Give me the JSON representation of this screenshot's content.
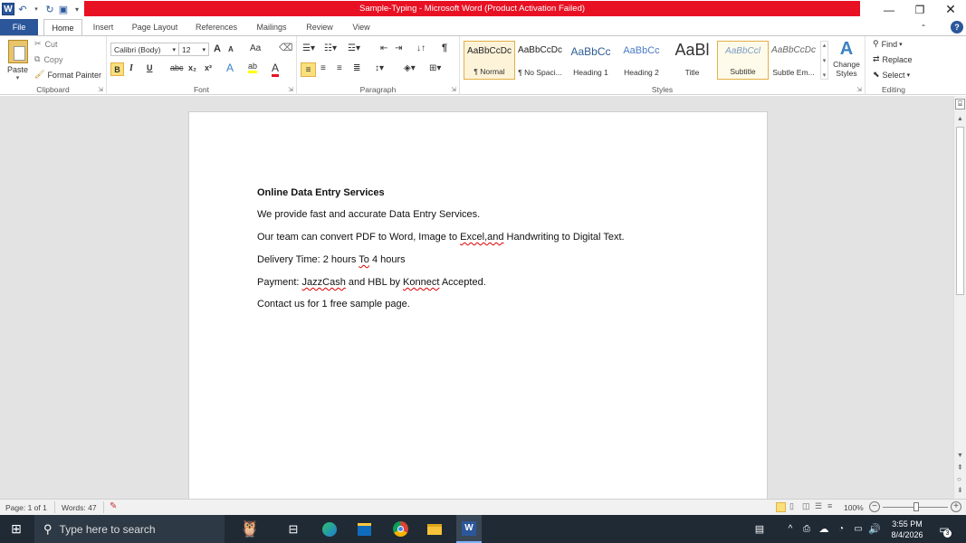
{
  "window": {
    "title": "Sample-Typing - Microsoft Word (Product Activation Failed)"
  },
  "qat": {
    "logo": "W"
  },
  "tabs": {
    "file": "File",
    "home": "Home",
    "insert": "Insert",
    "page_layout": "Page Layout",
    "references": "References",
    "mailings": "Mailings",
    "review": "Review",
    "view": "View"
  },
  "clipboard": {
    "paste": "Paste",
    "cut": "Cut",
    "copy": "Copy",
    "format_painter": "Format Painter",
    "label": "Clipboard"
  },
  "font": {
    "name": "Calibri (Body)",
    "size": "12",
    "label": "Font",
    "grow": "A",
    "shrink": "A",
    "case": "Aa",
    "bold": "B",
    "italic": "I",
    "underline": "U",
    "strike": "abc",
    "sub": "x₂",
    "sup": "x²"
  },
  "paragraph": {
    "label": "Paragraph",
    "pilcrow": "¶"
  },
  "styles": {
    "label": "Styles",
    "items": [
      {
        "preview": "AaBbCcDc",
        "name": "¶ Normal"
      },
      {
        "preview": "AaBbCcDc",
        "name": "¶ No Spaci..."
      },
      {
        "preview": "AaBbCc",
        "name": "Heading 1"
      },
      {
        "preview": "AaBbCc",
        "name": "Heading 2"
      },
      {
        "preview": "AaBl",
        "name": "Title"
      },
      {
        "preview": "AaBbCcl",
        "name": "Subtitle"
      },
      {
        "preview": "AaBbCcDc",
        "name": "Subtle Em..."
      }
    ],
    "change": "Change Styles"
  },
  "editing": {
    "find": "Find",
    "replace": "Replace",
    "select": "Select",
    "label": "Editing"
  },
  "document": {
    "heading": "Online Data Entry Services",
    "line1": "We provide fast and accurate Data Entry Services.",
    "line2_a": "Our team can convert PDF to Word, Image to ",
    "line2_b": "Excel,and",
    "line2_c": " Handwriting to Digital Text.",
    "line3_a": "Delivery Time: 2 hours ",
    "line3_b": "To",
    "line3_c": " 4 hours",
    "line4_a": "Payment: ",
    "line4_b": "JazzCash",
    "line4_c": " and HBL by ",
    "line4_d": "Konnect",
    "line4_e": " Accepted.",
    "line5": "Contact us for 1 free sample page."
  },
  "status": {
    "page": "Page: 1 of 1",
    "words": "Words: 47",
    "zoom": "100%"
  },
  "taskbar": {
    "search": "Type here to search",
    "time": "3:55 PM",
    "date": "8/4/2026",
    "notif_count": "3"
  }
}
